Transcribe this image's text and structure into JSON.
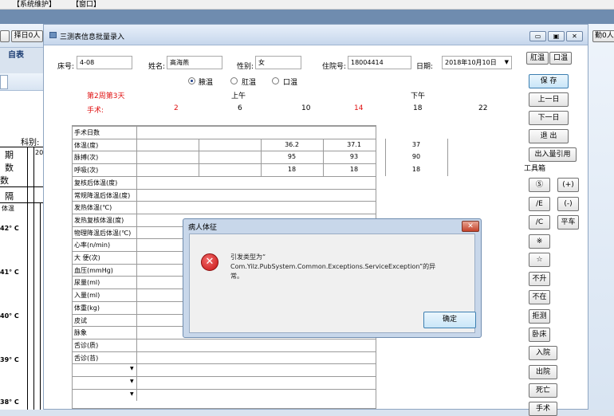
{
  "background_app": {
    "menu": [
      "【系统维护】",
      "【窗口】"
    ],
    "toolbar_partial": "择日0人",
    "toolbar_partial_right": "勤0人",
    "side_label": "自表",
    "left_labels": [
      "科别:",
      "期",
      "数",
      "数",
      "隔",
      "体温"
    ],
    "left_col_value": "20",
    "temperature_ticks": [
      "42° C",
      "41° C",
      "40° C",
      "39° C",
      "38° C"
    ]
  },
  "main_window": {
    "title": "三测表信息批量录入",
    "buttons": {
      "minimize": "▭",
      "restore": "▣",
      "close": "✕"
    },
    "patient": {
      "bed_label": "床号:",
      "bed_value": "4-08",
      "name_label": "姓名:",
      "name_value": "高海燕",
      "gender_label": "性别:",
      "gender_value": "女",
      "admission_label": "住院号:",
      "admission_value": "18004414",
      "date_label": "日期:",
      "date_value": "2018年10月10日"
    },
    "temperature_type": {
      "options": [
        "腋温",
        "肛温",
        "口温"
      ],
      "selected": "腋温"
    },
    "period": {
      "am": "上午",
      "pm": "下午"
    },
    "week_info": "第2周第3天",
    "surgery_label": "手术:",
    "hours": [
      "2",
      "6",
      "10",
      "14",
      "18",
      "22"
    ],
    "hour_colors": {
      "highlight": "#e01010",
      "normal": "#000000"
    },
    "rows": [
      "手术日数",
      "体温(度)",
      "脉搏(次)",
      "呼吸(次)",
      "复核后体温(度)",
      "常规降温后体温(度)",
      "发热体温(℃)",
      "发热复核体温(度)",
      "物理降温后体温(℃)",
      "心率(n/min)",
      "大 便(次)",
      "血压(mmHg)",
      "尿量(ml)",
      "入量(ml)",
      "体重(kg)",
      "皮试",
      "脉象",
      "舌诊(质)",
      "舌诊(苔)"
    ],
    "values": {
      "temperature": [
        "",
        "",
        "36.2",
        "37.1",
        "37",
        ""
      ],
      "pulse": [
        "",
        "",
        "95",
        "93",
        "90",
        ""
      ],
      "respiration": [
        "",
        "",
        "18",
        "18",
        "18",
        ""
      ]
    },
    "right_panel": {
      "top_buttons": [
        "肛温",
        "口温"
      ],
      "actions": [
        "保 存",
        "上一日",
        "下一日",
        "退 出",
        "出入量引用"
      ],
      "toolbox_label": "工具箱",
      "tools": [
        [
          "Ⓢ",
          "(+)"
        ],
        [
          "/E",
          "(-)"
        ],
        [
          "/C",
          "平车"
        ],
        [
          "※"
        ],
        [
          "☆"
        ],
        [
          "不升"
        ],
        [
          "不在"
        ],
        [
          "拒测"
        ],
        [
          "卧床"
        ],
        [
          "入院"
        ],
        [
          "出院"
        ],
        [
          "死亡"
        ],
        [
          "手术"
        ]
      ]
    }
  },
  "dialog": {
    "title": "病人体征",
    "message_line1": "引发类型为“",
    "message_line2": "Com.Yilz.PubSystem.Common.Exceptions.ServiceException”的异",
    "message_line3": "常。",
    "ok_label": "确定",
    "close_label": "✕"
  }
}
